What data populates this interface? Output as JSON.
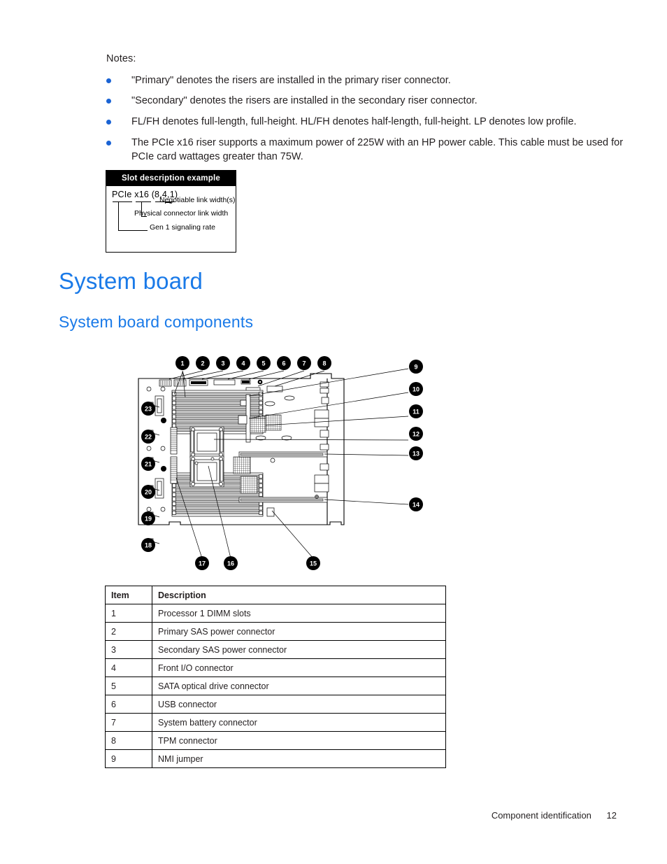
{
  "notes": {
    "label": "Notes:",
    "items": [
      "\"Primary\" denotes the risers are installed in the primary riser connector.",
      "\"Secondary\" denotes the risers are installed in the secondary riser connector.",
      "FL/FH denotes full-length, full-height. HL/FH denotes half-length, full-height. LP denotes low profile.",
      "The PCIe x16 riser supports a maximum power of 225W with an HP power cable. This cable must be used for PCIe card wattages greater than 75W."
    ]
  },
  "slot_example": {
    "title": "Slot description example",
    "expression": "PCIe x16 (8,4,1)",
    "labels": {
      "gen": "Gen 1 signaling rate",
      "physical": "Physical connector link width",
      "negotiable": "Negotiable link width(s)"
    }
  },
  "headings": {
    "h1": "System board",
    "h2": "System board components"
  },
  "figure": {
    "callouts_top": [
      "1",
      "2",
      "3",
      "4",
      "5",
      "6",
      "7",
      "8"
    ],
    "callouts_right": [
      "9",
      "10",
      "11",
      "12",
      "13",
      "14"
    ],
    "callouts_left": [
      "23",
      "22",
      "21",
      "20",
      "19",
      "18"
    ],
    "callouts_bottom": [
      "17",
      "16",
      "15"
    ]
  },
  "table": {
    "headers": [
      "Item",
      "Description"
    ],
    "rows": [
      [
        "1",
        "Processor 1 DIMM slots"
      ],
      [
        "2",
        "Primary SAS power connector"
      ],
      [
        "3",
        "Secondary SAS power connector"
      ],
      [
        "4",
        "Front I/O connector"
      ],
      [
        "5",
        "SATA optical drive connector"
      ],
      [
        "6",
        "USB connector"
      ],
      [
        "7",
        "System battery connector"
      ],
      [
        "8",
        "TPM connector"
      ],
      [
        "9",
        "NMI jumper"
      ]
    ]
  },
  "footer": {
    "section": "Component identification",
    "page": "12"
  },
  "colors": {
    "heading_blue": "#1a7ae8",
    "bullet_blue": "#1a63d4",
    "text": "#231f20"
  }
}
